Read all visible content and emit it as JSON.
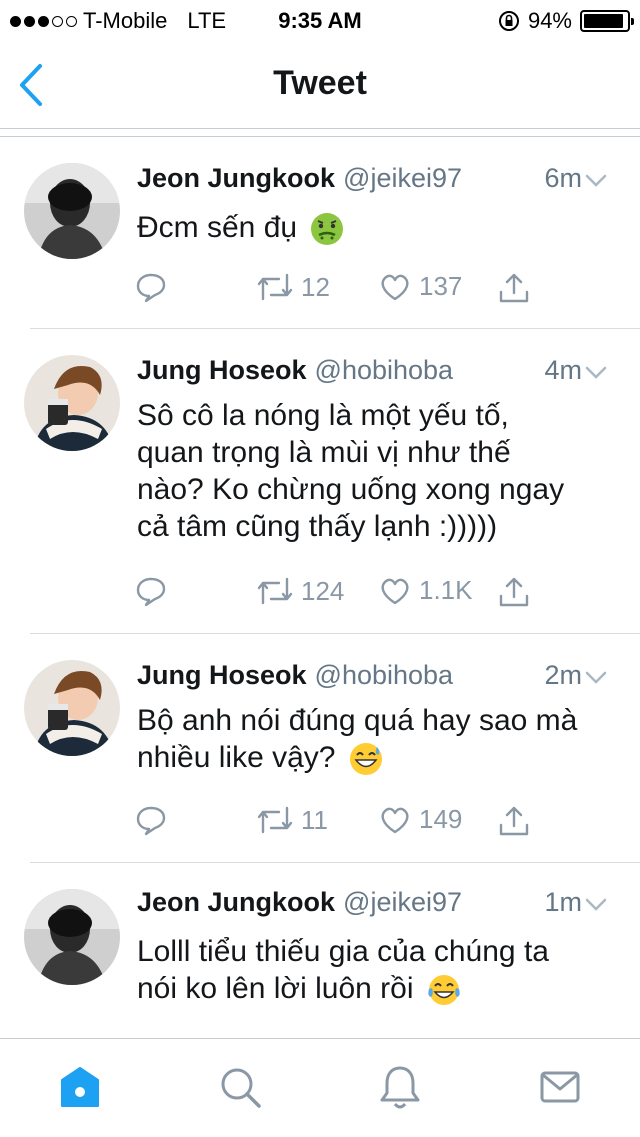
{
  "status_bar": {
    "carrier": "T-Mobile",
    "network": "LTE",
    "time": "9:35 AM",
    "battery": "94%",
    "battery_level": 0.94
  },
  "nav": {
    "title": "Tweet"
  },
  "tweets": [
    {
      "name": "Jeon Jungkook",
      "handle": "@jeikei97",
      "time": "6m",
      "text": "Đcm sến đụ",
      "emoji": "nauseated-face",
      "replies": "",
      "retweets": "12",
      "likes": "137"
    },
    {
      "name": "Jung Hoseok",
      "handle": "@hobihoba",
      "time": "4m",
      "lines": [
        "Sô cô la nóng là một yếu tố,",
        "quan trọng là mùi vị như thế",
        "nào? Ko chừng uống xong ngay",
        "cả tâm cũng thấy lạnh :)))))"
      ],
      "replies": "",
      "retweets": "124",
      "likes": "1.1K"
    },
    {
      "name": "Jung Hoseok",
      "handle": "@hobihoba",
      "time": "2m",
      "lines": [
        "Bộ anh nói đúng quá hay sao mà",
        "nhiều like vậy?"
      ],
      "emoji": "grinning-sweat-face",
      "replies": "",
      "retweets": "11",
      "likes": "149"
    },
    {
      "name": "Jeon Jungkook",
      "handle": "@jeikei97",
      "time": "1m",
      "lines": [
        "Lolll tiểu thiếu gia của chúng ta",
        "nói ko lên lời luôn rồi"
      ],
      "emoji": "tears-of-joy-face"
    }
  ],
  "tab_bar": {
    "items": [
      "home-icon",
      "search-icon",
      "notifications-icon",
      "messages-icon"
    ],
    "active": "home-icon"
  },
  "colors": {
    "accent": "#1da1f2",
    "text": "#14171a",
    "muted": "#657786"
  }
}
